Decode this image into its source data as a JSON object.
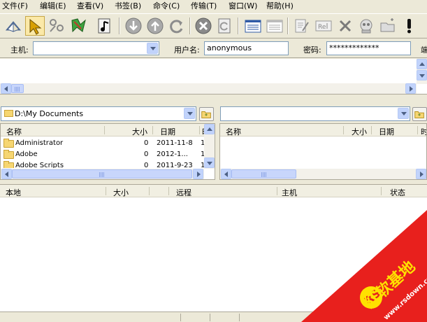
{
  "menu": {
    "items": [
      "文件(F)",
      "编辑(E)",
      "查看(V)",
      "书签(B)",
      "命令(C)",
      "传输(T)",
      "窗口(W)",
      "帮助(H)"
    ]
  },
  "toolbar": {
    "buttons": [
      "open-site-manager-icon",
      "connect-icon",
      "reconnect-icon",
      "disconnect-icon",
      "music-icon",
      "download-icon",
      "upload-icon",
      "refresh-icon",
      "stop-icon",
      "refresh-page-icon",
      "list-view-icon",
      "details-view-icon",
      "edit-icon",
      "rename-icon",
      "delete-icon",
      "properties-icon",
      "new-folder-icon",
      "info-icon"
    ]
  },
  "quickconnect": {
    "host_label": "主机:",
    "host_value": "",
    "user_label": "用户名:",
    "user_value": "anonymous",
    "pass_label": "密码:",
    "pass_value": "*************",
    "port_label": "端"
  },
  "local": {
    "path": "D:\\My Documents",
    "columns": [
      "名称",
      "大小",
      "日期",
      "时"
    ],
    "rows": [
      {
        "name": "Administrator",
        "size": "0",
        "date": "2011-11-8",
        "time": "1"
      },
      {
        "name": "Adobe",
        "size": "0",
        "date": "2012-1...",
        "time": "1"
      },
      {
        "name": "Adobe Scripts",
        "size": "0",
        "date": "2011-9-23",
        "time": "1"
      }
    ]
  },
  "remote": {
    "path": "",
    "columns": [
      "名称",
      "大小",
      "日期",
      "时"
    ]
  },
  "queue": {
    "columns": [
      "本地",
      "大小",
      "远程",
      "主机",
      "状态"
    ]
  },
  "watermark": {
    "brand": "红软基地",
    "site": "www.rsdown.cn"
  },
  "colors": {
    "watermark_red": "#e8201d",
    "watermark_yellow": "#ffe100"
  }
}
